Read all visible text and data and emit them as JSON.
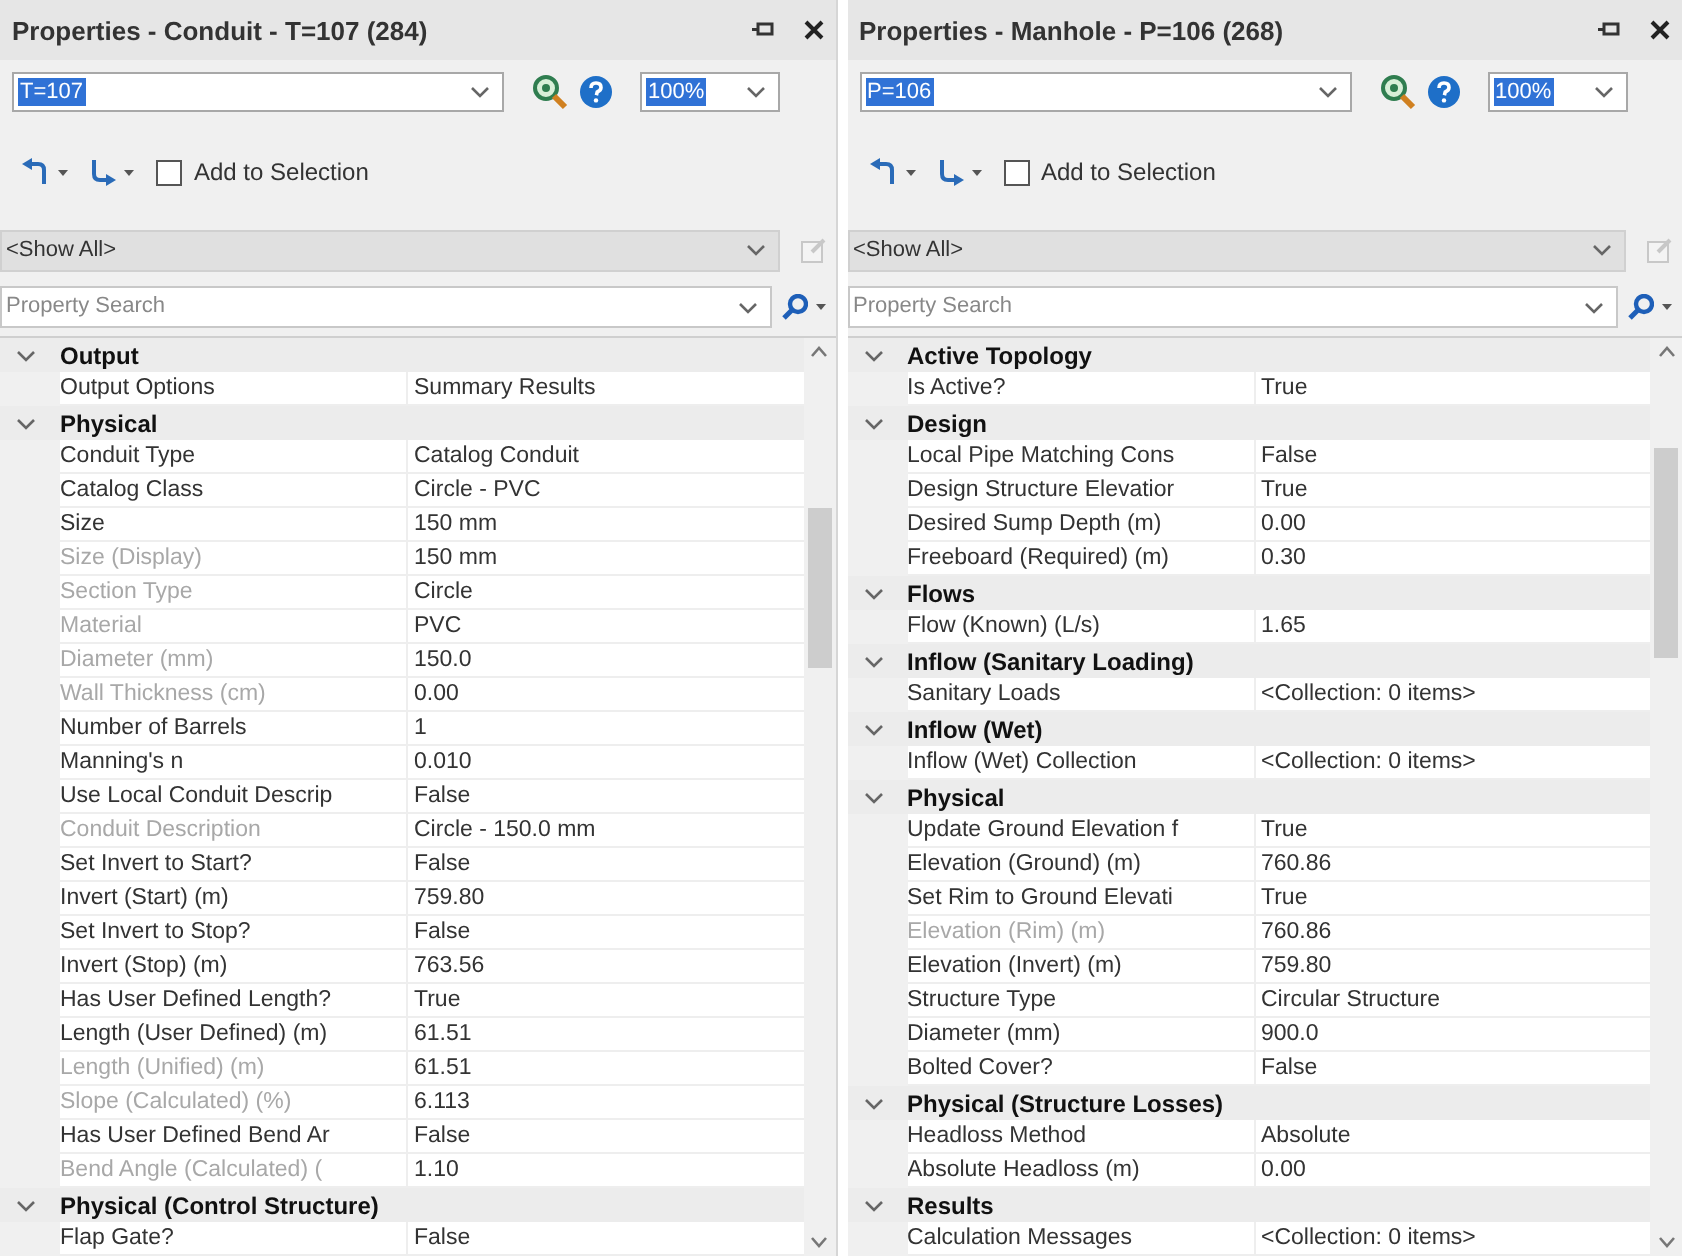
{
  "panels": [
    {
      "title": "Properties - Conduit - T=107 (284)",
      "element": {
        "value": "T=107",
        "text_selected": true
      },
      "zoom": {
        "value": "100%",
        "text_selected": true
      },
      "add_to_selection": {
        "label": "Add to Selection",
        "checked": false
      },
      "filter": "<Show All>",
      "search": {
        "placeholder": "Property Search"
      },
      "grid": [
        {
          "kind": "category",
          "name": "Output",
          "expanded": true
        },
        {
          "kind": "property",
          "name": "Output Options",
          "value": "Summary Results",
          "disabled": false
        },
        {
          "kind": "category",
          "name": "Physical",
          "expanded": true
        },
        {
          "kind": "property",
          "name": "Conduit Type",
          "value": "Catalog Conduit",
          "disabled": false
        },
        {
          "kind": "property",
          "name": "Catalog Class",
          "value": "Circle - PVC",
          "disabled": false
        },
        {
          "kind": "property",
          "name": "Size",
          "value": "150 mm",
          "disabled": false
        },
        {
          "kind": "property",
          "name": "Size (Display)",
          "value": "150 mm",
          "disabled": true
        },
        {
          "kind": "property",
          "name": "Section Type",
          "value": "Circle",
          "disabled": true
        },
        {
          "kind": "property",
          "name": "Material",
          "value": "PVC",
          "disabled": true
        },
        {
          "kind": "property",
          "name": "Diameter (mm)",
          "value": "150.0",
          "disabled": true
        },
        {
          "kind": "property",
          "name": "Wall Thickness (cm)",
          "value": "0.00",
          "disabled": true
        },
        {
          "kind": "property",
          "name": "Number of Barrels",
          "value": "1",
          "disabled": false
        },
        {
          "kind": "property",
          "name": "Manning's n",
          "value": "0.010",
          "disabled": false
        },
        {
          "kind": "property",
          "name": "Use Local Conduit Descrip",
          "value": "False",
          "disabled": false
        },
        {
          "kind": "property",
          "name": "Conduit Description",
          "value": "Circle - 150.0 mm",
          "disabled": true
        },
        {
          "kind": "property",
          "name": "Set Invert to Start?",
          "value": "False",
          "disabled": false
        },
        {
          "kind": "property",
          "name": "Invert (Start) (m)",
          "value": "759.80",
          "disabled": false
        },
        {
          "kind": "property",
          "name": "Set Invert to Stop?",
          "value": "False",
          "disabled": false
        },
        {
          "kind": "property",
          "name": "Invert (Stop) (m)",
          "value": "763.56",
          "disabled": false
        },
        {
          "kind": "property",
          "name": "Has User Defined Length?",
          "value": "True",
          "disabled": false
        },
        {
          "kind": "property",
          "name": "Length (User Defined) (m)",
          "value": "61.51",
          "disabled": false
        },
        {
          "kind": "property",
          "name": "Length (Unified) (m)",
          "value": "61.51",
          "disabled": true
        },
        {
          "kind": "property",
          "name": "Slope (Calculated) (%)",
          "value": "6.113",
          "disabled": true
        },
        {
          "kind": "property",
          "name": "Has User Defined Bend Ar",
          "value": "False",
          "disabled": false
        },
        {
          "kind": "property",
          "name": "Bend Angle (Calculated) (",
          "value": "1.10",
          "disabled": true
        },
        {
          "kind": "category",
          "name": "Physical (Control Structure)",
          "expanded": true
        },
        {
          "kind": "property",
          "name": "Flap Gate?",
          "value": "False",
          "disabled": false
        }
      ]
    },
    {
      "title": "Properties - Manhole - P=106 (268)",
      "element": {
        "value": "P=106",
        "text_selected": true
      },
      "zoom": {
        "value": "100%",
        "text_selected": true
      },
      "add_to_selection": {
        "label": "Add to Selection",
        "checked": false
      },
      "filter": "<Show All>",
      "search": {
        "placeholder": "Property Search"
      },
      "grid": [
        {
          "kind": "category",
          "name": "Active Topology",
          "expanded": true
        },
        {
          "kind": "property",
          "name": "Is Active?",
          "value": "True",
          "disabled": false
        },
        {
          "kind": "category",
          "name": "Design",
          "expanded": true
        },
        {
          "kind": "property",
          "name": "Local Pipe Matching Cons",
          "value": "False",
          "disabled": false
        },
        {
          "kind": "property",
          "name": "Design Structure Elevatior",
          "value": "True",
          "disabled": false
        },
        {
          "kind": "property",
          "name": "Desired Sump Depth (m)",
          "value": "0.00",
          "disabled": false
        },
        {
          "kind": "property",
          "name": "Freeboard (Required) (m)",
          "value": "0.30",
          "disabled": false
        },
        {
          "kind": "category",
          "name": "Flows",
          "expanded": true
        },
        {
          "kind": "property",
          "name": "Flow (Known) (L/s)",
          "value": "1.65",
          "disabled": false
        },
        {
          "kind": "category",
          "name": "Inflow (Sanitary Loading)",
          "expanded": true
        },
        {
          "kind": "property",
          "name": "Sanitary Loads",
          "value": "<Collection: 0 items>",
          "disabled": false
        },
        {
          "kind": "category",
          "name": "Inflow (Wet)",
          "expanded": true
        },
        {
          "kind": "property",
          "name": "Inflow (Wet) Collection",
          "value": "<Collection: 0 items>",
          "disabled": false
        },
        {
          "kind": "category",
          "name": "Physical",
          "expanded": true
        },
        {
          "kind": "property",
          "name": "Update Ground Elevation f",
          "value": "True",
          "disabled": false
        },
        {
          "kind": "property",
          "name": "Elevation (Ground) (m)",
          "value": "760.86",
          "disabled": false
        },
        {
          "kind": "property",
          "name": "Set Rim to Ground Elevati",
          "value": "True",
          "disabled": false
        },
        {
          "kind": "property",
          "name": "Elevation (Rim) (m)",
          "value": "760.86",
          "disabled": true
        },
        {
          "kind": "property",
          "name": "Elevation (Invert) (m)",
          "value": "759.80",
          "disabled": false
        },
        {
          "kind": "property",
          "name": "Structure Type",
          "value": "Circular Structure",
          "disabled": false
        },
        {
          "kind": "property",
          "name": "Diameter (mm)",
          "value": "900.0",
          "disabled": false
        },
        {
          "kind": "property",
          "name": "Bolted Cover?",
          "value": "False",
          "disabled": false
        },
        {
          "kind": "category",
          "name": "Physical (Structure Losses)",
          "expanded": true
        },
        {
          "kind": "property",
          "name": "Headloss Method",
          "value": "Absolute",
          "disabled": false
        },
        {
          "kind": "property",
          "name": "Absolute Headloss (m)",
          "value": "0.00",
          "disabled": false
        },
        {
          "kind": "category",
          "name": "Results",
          "expanded": true
        },
        {
          "kind": "property",
          "name": "Calculation Messages",
          "value": "<Collection: 0 items>",
          "disabled": false
        }
      ]
    }
  ]
}
